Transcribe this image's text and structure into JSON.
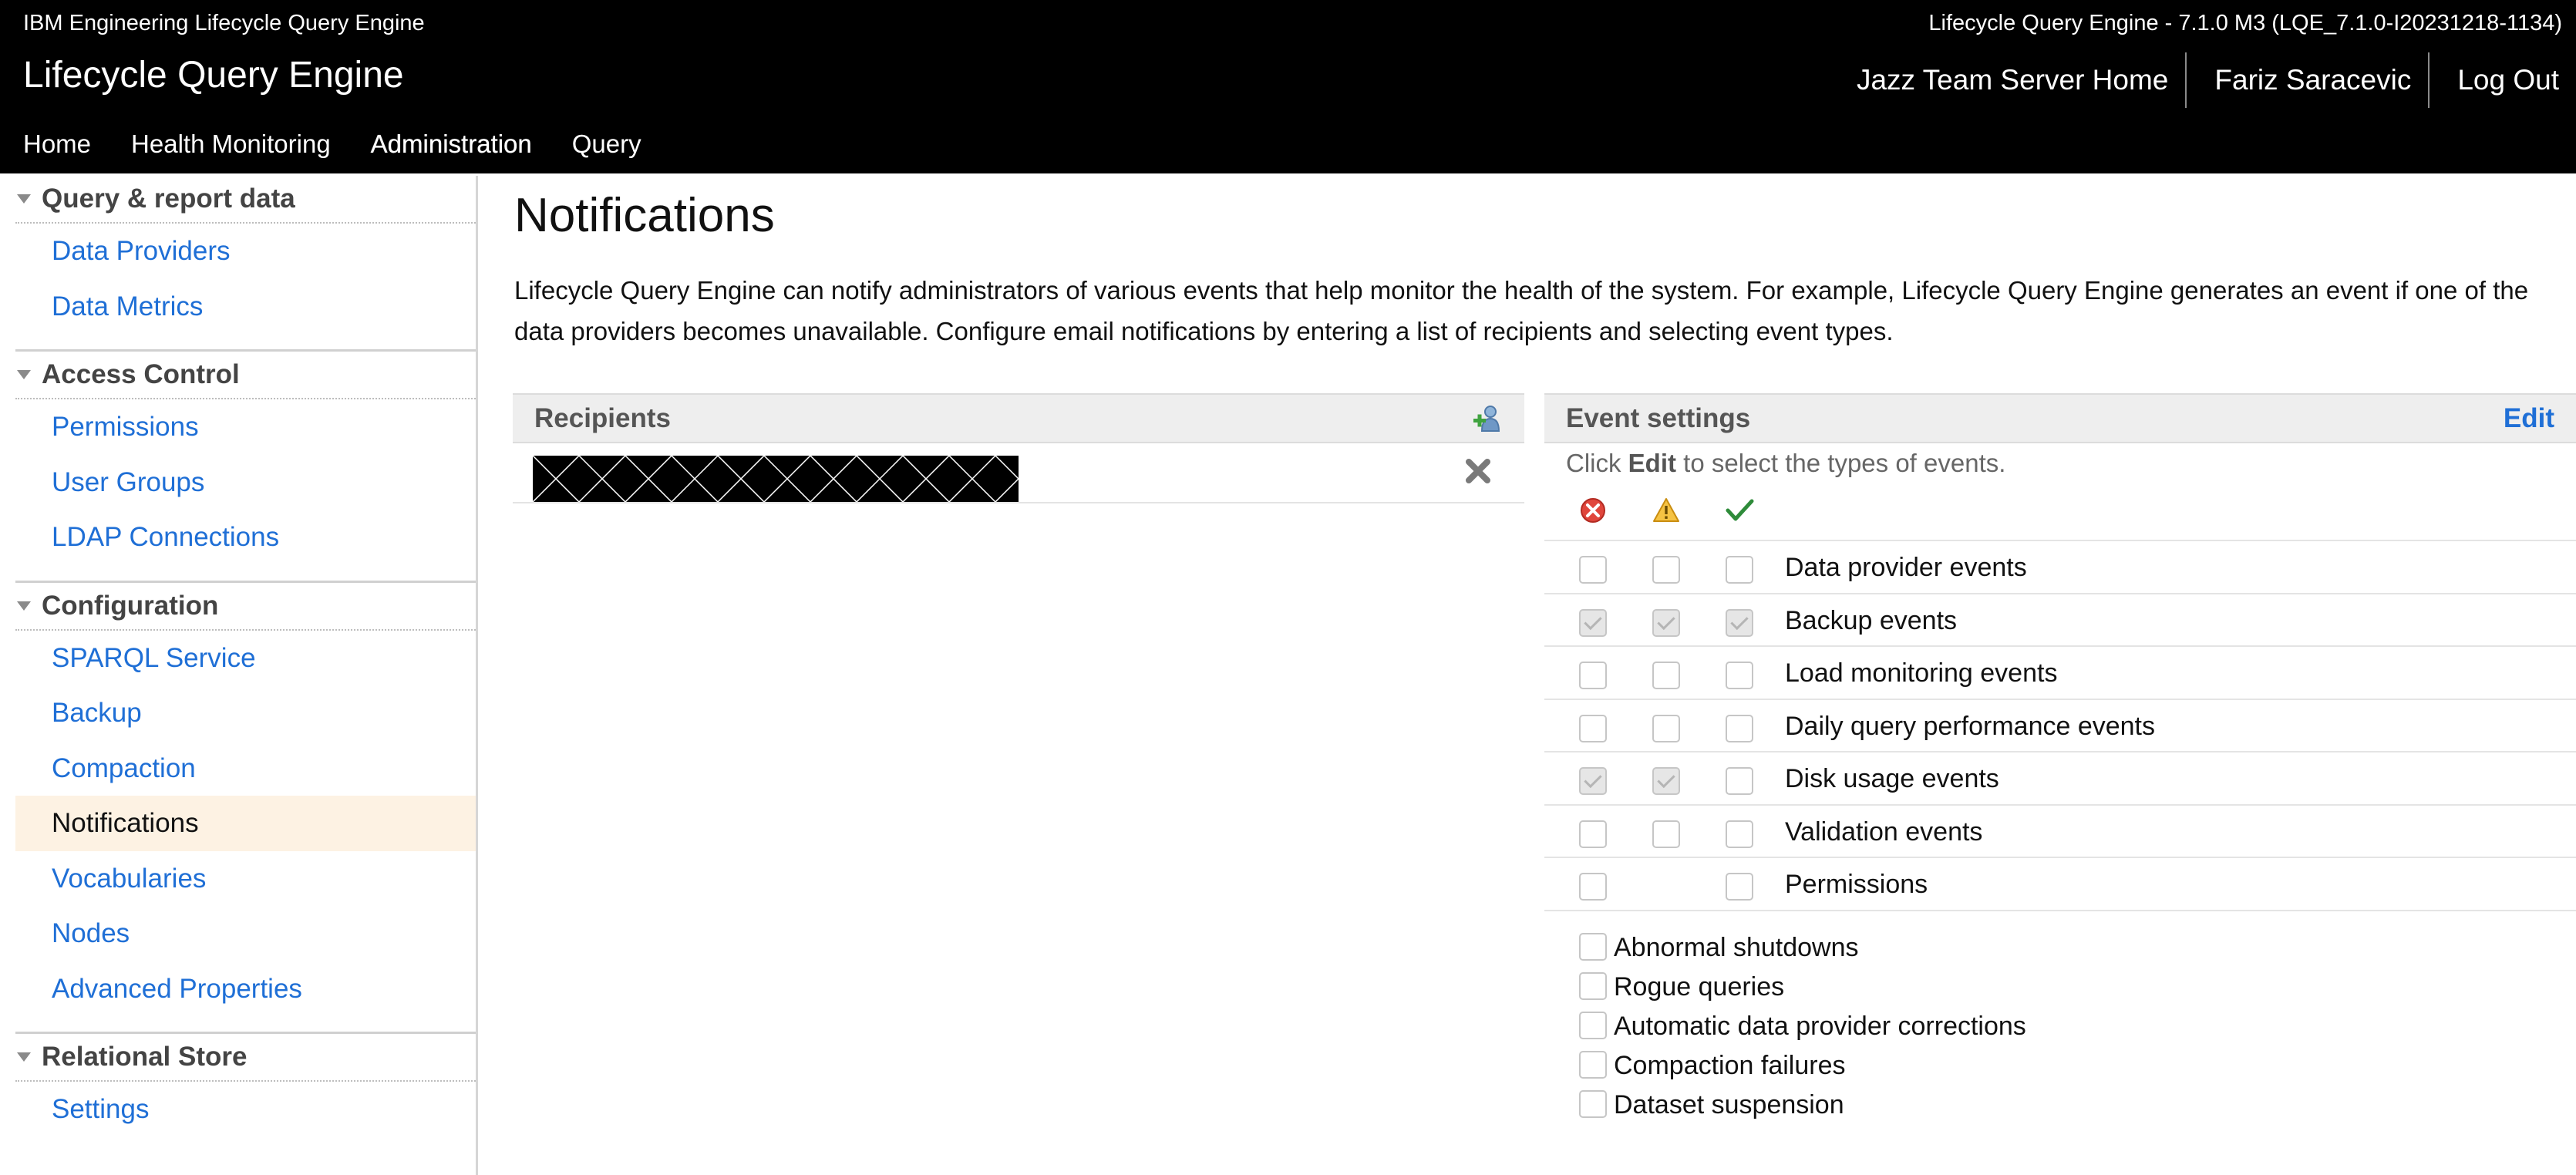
{
  "header": {
    "product_label": "IBM Engineering Lifecycle Query Engine",
    "version_label": "Lifecycle Query Engine - 7.1.0 M3 (LQE_7.1.0-I20231218-1134)",
    "app_title": "Lifecycle Query Engine",
    "links": [
      "Jazz Team Server Home",
      "Fariz Saracevic",
      "Log Out"
    ]
  },
  "nav": {
    "items": [
      "Home",
      "Health Monitoring",
      "Administration",
      "Query"
    ],
    "active": "Administration"
  },
  "sidebar": {
    "sections": [
      {
        "title": "Query & report data",
        "items": [
          "Data Providers",
          "Data Metrics"
        ]
      },
      {
        "title": "Access Control",
        "items": [
          "Permissions",
          "User Groups",
          "LDAP Connections"
        ]
      },
      {
        "title": "Configuration",
        "items": [
          "SPARQL Service",
          "Backup",
          "Compaction",
          "Notifications",
          "Vocabularies",
          "Nodes",
          "Advanced Properties"
        ]
      },
      {
        "title": "Relational Store",
        "items": [
          "Settings"
        ]
      }
    ],
    "active_item": "Notifications"
  },
  "main": {
    "title": "Notifications",
    "intro": "Lifecycle Query Engine can notify administrators of various events that help monitor the health of the system. For example, Lifecycle Query Engine generates an event if one of the data providers becomes unavailable. Configure email notifications by entering a list of recipients and selecting event types."
  },
  "recipients": {
    "title": "Recipients",
    "add_icon": "add-user-icon",
    "remove_icon": "remove-icon"
  },
  "event_settings": {
    "title": "Event settings",
    "edit_label": "Edit",
    "hint_prefix": "Click ",
    "hint_bold": "Edit",
    "hint_suffix": " to select the types of events.",
    "severity_icons": [
      "error-icon",
      "warning-icon",
      "success-icon"
    ],
    "events": [
      {
        "label": "Data provider events",
        "error": false,
        "warning": false,
        "info": false
      },
      {
        "label": "Backup events",
        "error": true,
        "warning": true,
        "info": true
      },
      {
        "label": "Load monitoring events",
        "error": false,
        "warning": false,
        "info": false
      },
      {
        "label": "Daily query performance events",
        "error": false,
        "warning": false,
        "info": false
      },
      {
        "label": "Disk usage events",
        "error": true,
        "warning": true,
        "info": false
      },
      {
        "label": "Validation events",
        "error": false,
        "warning": false,
        "info": false
      },
      {
        "label": "Permissions",
        "error": false,
        "warning": null,
        "info": false
      }
    ],
    "extra_events": [
      {
        "label": "Abnormal shutdowns",
        "checked": false
      },
      {
        "label": "Rogue queries",
        "checked": false
      },
      {
        "label": "Automatic data provider corrections",
        "checked": false
      },
      {
        "label": "Compaction failures",
        "checked": false
      },
      {
        "label": "Dataset suspension",
        "checked": false
      }
    ]
  },
  "colors": {
    "header_bg": "#000000",
    "link": "#1f6fd6",
    "sidebar_active_bg": "#fdf2e3",
    "panel_head_bg": "#eeeeee"
  }
}
